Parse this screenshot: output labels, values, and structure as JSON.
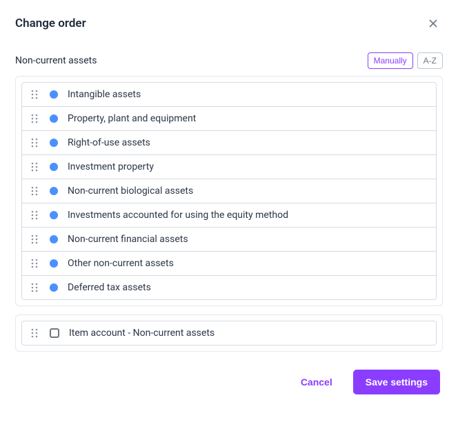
{
  "dialog": {
    "title": "Change order",
    "section_label": "Non-current assets",
    "sort": {
      "manual_label": "Manually",
      "alpha_label": "A-Z"
    },
    "items": [
      {
        "label": "Intangible assets"
      },
      {
        "label": "Property, plant and equipment"
      },
      {
        "label": "Right-of-use assets"
      },
      {
        "label": "Investment property"
      },
      {
        "label": "Non-current biological assets"
      },
      {
        "label": "Investments accounted for using the equity method"
      },
      {
        "label": "Non-current financial assets"
      },
      {
        "label": "Other non-current assets"
      },
      {
        "label": "Deferred tax assets"
      }
    ],
    "extra_item": {
      "label": "Item account - Non-current assets"
    },
    "buttons": {
      "cancel": "Cancel",
      "save": "Save settings"
    }
  }
}
